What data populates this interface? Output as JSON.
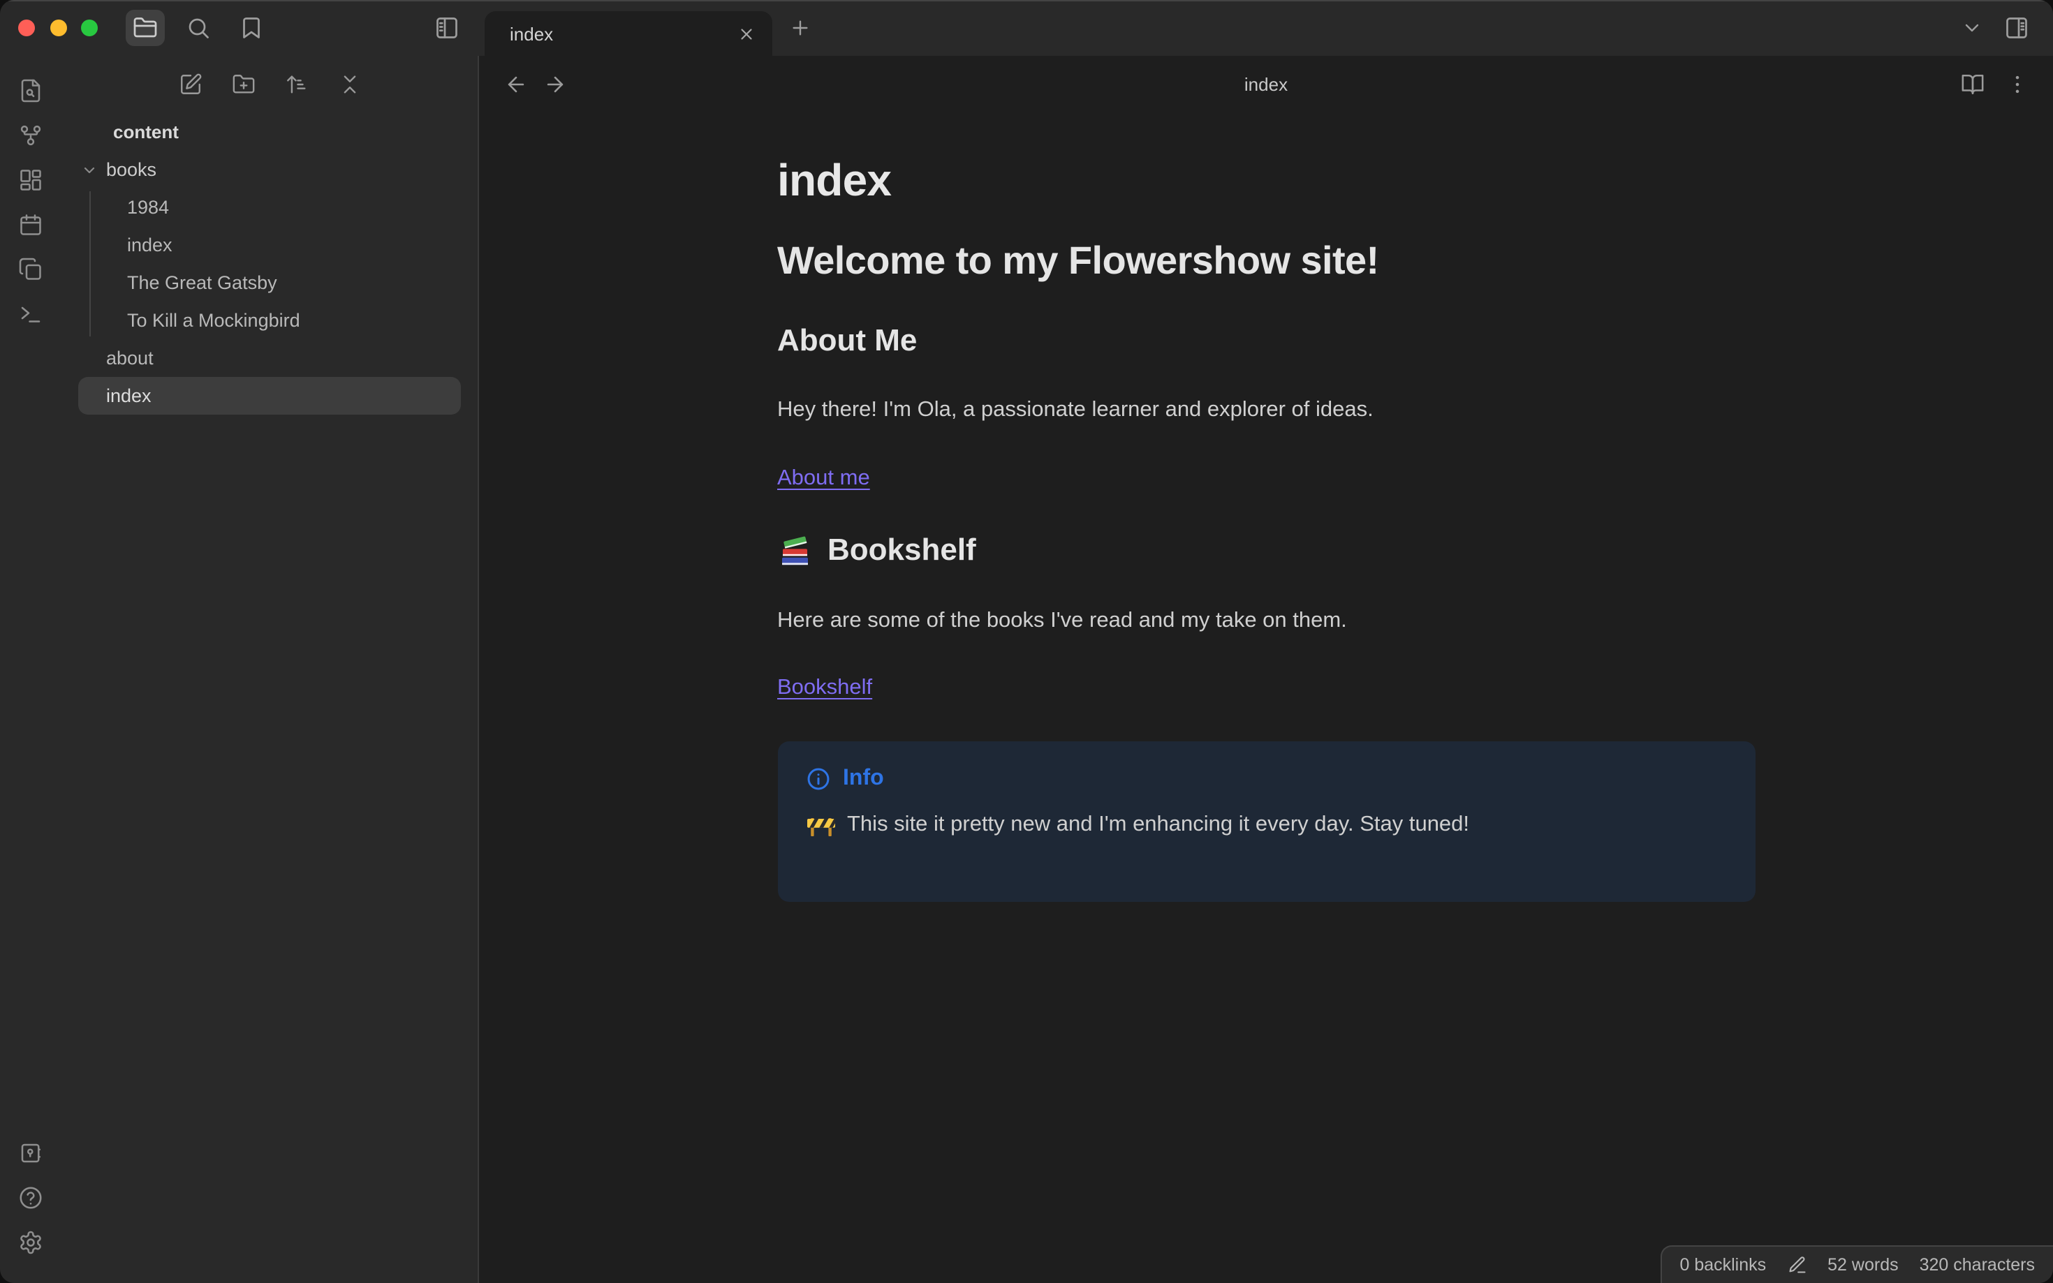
{
  "colors": {
    "chrome_bg": "#292929",
    "editor_bg": "#1e1e1e",
    "accent_link": "#7f6df2",
    "callout_info_color": "#2e74e5",
    "callout_bg": "#1e2836",
    "selected_file_bg": "#3d3d3d",
    "traffic_red": "#ff5f57",
    "traffic_yellow": "#febc2e",
    "traffic_green": "#28c840"
  },
  "titlebar": {
    "tab_title": "index",
    "icons": [
      "folder-icon",
      "search-icon",
      "bookmark-icon",
      "panel-left-icon",
      "chevron-down-icon",
      "panel-right-icon",
      "plus-icon",
      "close-icon"
    ]
  },
  "ribbon": {
    "top_icons": [
      "file-search-icon",
      "graph-fork-icon",
      "layout-dashboard-icon",
      "calendar-icon",
      "copy-icon",
      "terminal-icon"
    ],
    "bottom_icons": [
      "vault-icon",
      "help-icon",
      "settings-icon"
    ]
  },
  "sidebar": {
    "toolbar_icons": [
      "new-note-icon",
      "new-folder-icon",
      "sort-icon",
      "collapse-all-icon"
    ],
    "vault_name": "content",
    "tree": [
      {
        "label": "books",
        "type": "folder",
        "expanded": true,
        "children": [
          "1984",
          "index",
          "The Great Gatsby",
          "To Kill a Mockingbird"
        ]
      },
      {
        "label": "about",
        "type": "file",
        "selected": false
      },
      {
        "label": "index",
        "type": "file",
        "selected": true
      }
    ]
  },
  "editor": {
    "header": {
      "title": "index",
      "icons": [
        "arrow-left-icon",
        "arrow-right-icon",
        "book-open-icon",
        "more-vertical-icon"
      ]
    },
    "content": {
      "inline_title": "index",
      "welcome_heading": "Welcome to my Flowershow site!",
      "about": {
        "heading": "About Me",
        "text": "Hey there! I'm Ola, a passionate learner and explorer of ideas.",
        "link": "About me"
      },
      "bookshelf": {
        "emoji": "📚",
        "heading": "Bookshelf",
        "text": "Here are some of the books I've read and my take on them.",
        "link": "Bookshelf"
      },
      "callout": {
        "title": "Info",
        "emoji": "🚧",
        "text": "This site it pretty new and I'm enhancing it every day. Stay tuned!"
      }
    }
  },
  "status_bar": {
    "backlinks": "0 backlinks",
    "words": "52 words",
    "characters": "320 characters"
  }
}
